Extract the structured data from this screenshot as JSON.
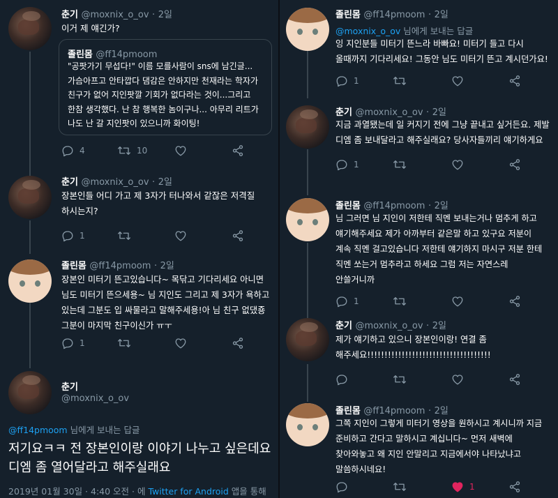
{
  "left": {
    "tweets": [
      {
        "name": "춘기",
        "handle": "@moxnix_o_ov",
        "time": "2일",
        "text": "이거 제 얘긴가?",
        "quote": {
          "name": "졸린몸",
          "handle": "@ff14pmoom",
          "text": "\"공팟가기 무섭다!\" 이름 모를사람이 sns에 남긴글...\n가슴아프고 안타깝다 댐감은 안하지만 천재라는 학자가\n친구가 없어 지인팟깔 기회가 없다라는 것이...그리고\n한참 생각했다. 난 참 행복한 놈이구나... 아무리 리트가\n나도 난 갈 지인팟이 있으니까 화이팅!"
        },
        "reply_count": "4",
        "retweet_count": "10",
        "like_count": ""
      },
      {
        "name": "춘기",
        "handle": "@moxnix_o_ov",
        "time": "2일",
        "text": "장본인들 어디 가고 제 3자가 터나와서 같잖은 저격질\n하시는지?",
        "reply_count": "1",
        "retweet_count": "",
        "like_count": ""
      },
      {
        "name": "졸린몸",
        "handle": "@ff14pmoom",
        "time": "2일",
        "text": "장본인 미터기 뜬고있습니다~ 목닦고 기다리세요 아니면\n님도 미터기 뜬으세용~ 님 지인도 그리고 제 3자가 욕하고\n있는데 그분도 입 싸물라고 말해주세용!아 님 친구 없댔죵\n그분이 마지막 친구이신가 ㅠㅜ",
        "reply_count": "1",
        "retweet_count": "",
        "like_count": ""
      }
    ],
    "main": {
      "name": "춘기",
      "handle": "@moxnix_o_ov",
      "reply_to_mention": "@ff14pmoom",
      "reply_to_suffix": " 님에게 보내는 답글",
      "text": "저기요ㅋㅋ 전 장본인이랑 이야기 나누고 싶은데요\n디엠 좀 열어달라고 해주실래요",
      "footer_date": "2019년 01월 30일 · 4:40 오전 · 에 ",
      "footer_app": "Twitter for Android",
      "footer_suffix": " 앱을 통해"
    }
  },
  "right": {
    "tweets": [
      {
        "name": "졸린몸",
        "handle": "@ff14pmoom",
        "time": "2일",
        "reply_to_mention": "@moxnix_o_ov",
        "reply_to_suffix": " 님에게 보내는 답글",
        "text": "잉 지인분들 미터기 뜬느라 바빠요! 미터기 들고 다시\n올때까지 기다리세요! 그동안 님도 미터기 뜬고 계시던가요!",
        "reply_count": "1",
        "retweet_count": "",
        "like_count": ""
      },
      {
        "name": "춘기",
        "handle": "@moxnix_o_ov",
        "time": "2일",
        "text": "지금 과열됐는데 일 커지기 전에 그냥 끝내고 싶거든요. 제발\n디엠 좀 보내달라고 해주실래요? 당사자들끼리 얘기하게요",
        "reply_count": "1",
        "retweet_count": "",
        "like_count": ""
      },
      {
        "name": "졸린몸",
        "handle": "@ff14pmoom",
        "time": "2일",
        "text": "님 그러면 님 지인이 저한테 직멘 보내는거나 멈추게 하고\n얘기해주세요 제가 아까부터  같은말 하고 있구요 저분이\n계속 직멘 걸고있습니다 저한테 얘기하지 마시구 저분 한테\n직멘 쏘는거 멈추라고 하세요 그럼 저는 자연스레\n안쓸거니까",
        "reply_count": "1",
        "retweet_count": "",
        "like_count": ""
      },
      {
        "name": "춘기",
        "handle": "@moxnix_o_ov",
        "time": "2일",
        "text": "제가 얘기하고 있으니 장본인이랑! 연결 좀\n해주세요!!!!!!!!!!!!!!!!!!!!!!!!!!!!!!!!!!!!",
        "reply_count": "",
        "retweet_count": "",
        "like_count": ""
      },
      {
        "name": "졸린몸",
        "handle": "@ff14pmoom",
        "time": "2일",
        "text": "그쪽 지인이 그렇게 미터기 영상을 원하시고 계시니까 지금\n준비하고 간다고 말하시고 계십니다~ 먼저 새벽에\n찾아와놓고 왜 지인 안말리고 지금에서야 나타났냐고\n말씀하시네요!",
        "reply_count": "",
        "retweet_count": "",
        "like_count": "1"
      }
    ]
  },
  "colors": {
    "background": "#15202b",
    "text": "#ffffff",
    "secondary": "#8899a6",
    "link": "#1da1f2",
    "like": "#e0245e",
    "line": "#38444d"
  },
  "icons": [
    "reply-icon",
    "retweet-icon",
    "like-icon",
    "share-icon"
  ]
}
